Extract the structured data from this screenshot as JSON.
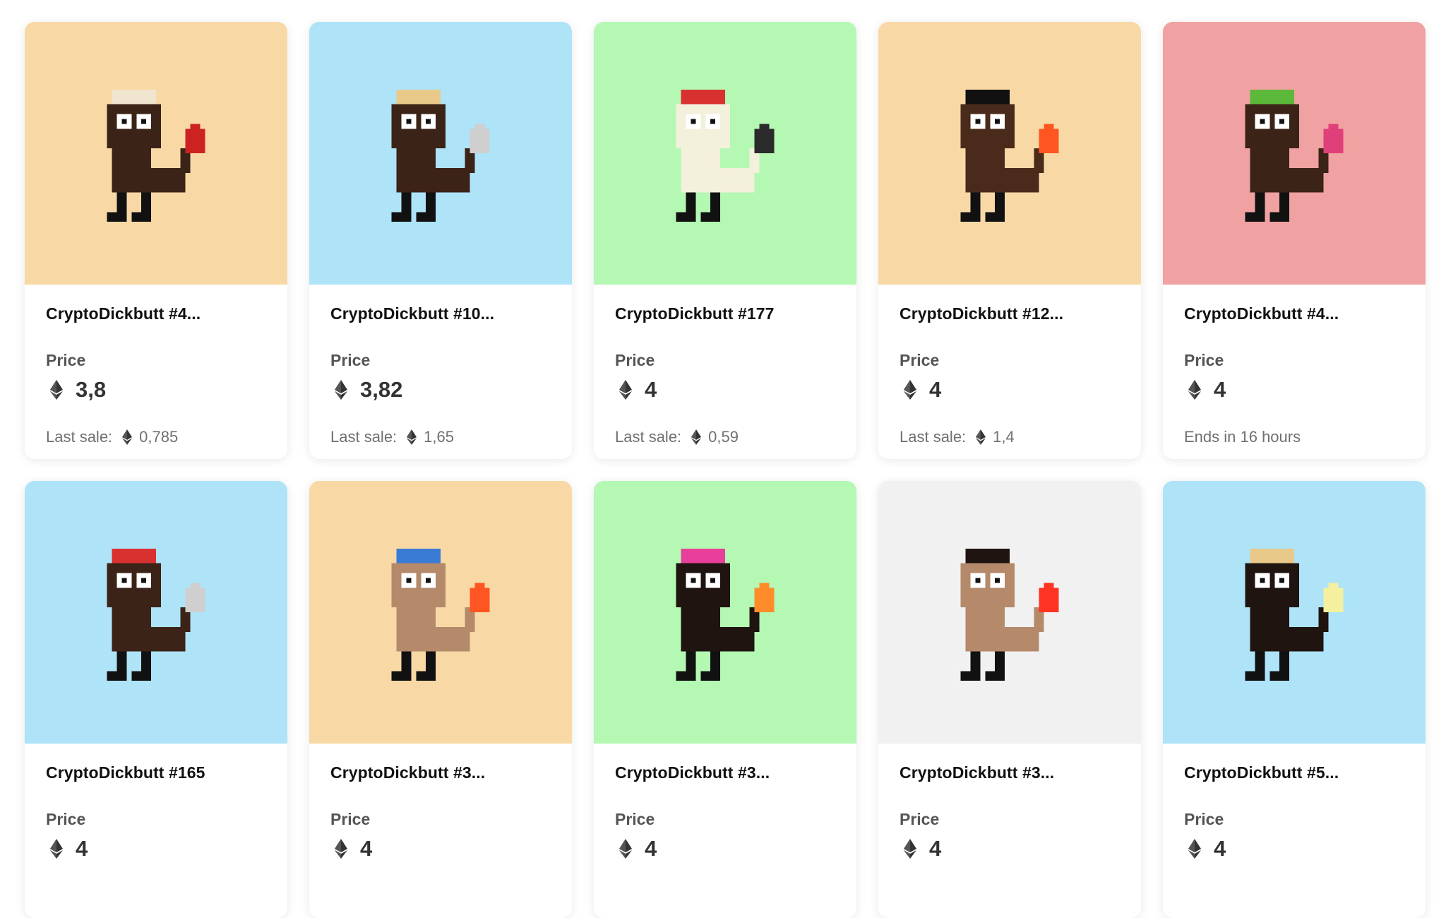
{
  "labels": {
    "price": "Price",
    "last_sale_prefix": "Last sale:"
  },
  "icons": {
    "currency": "ethereum-diamond-icon"
  },
  "cards": [
    {
      "name": "CryptoDickbutt #4...",
      "price": "3,8",
      "footer_type": "last_sale",
      "last_sale": "0,785",
      "bg": "#f8d9a6",
      "body": "#3b2317",
      "hat": "#f0e6d0",
      "prop": "#cc2222"
    },
    {
      "name": "CryptoDickbutt #10...",
      "price": "3,82",
      "footer_type": "last_sale",
      "last_sale": "1,65",
      "bg": "#aee3f8",
      "body": "#3b2317",
      "hat": "#e8c98a",
      "prop": "#cfcfcf"
    },
    {
      "name": "CryptoDickbutt #177",
      "price": "4",
      "footer_type": "last_sale",
      "last_sale": "0,59",
      "bg": "#b4f8b4",
      "body": "#f3f0dc",
      "hat": "#d93030",
      "prop": "#2b2b2b"
    },
    {
      "name": "CryptoDickbutt #12...",
      "price": "4",
      "footer_type": "last_sale",
      "last_sale": "1,4",
      "bg": "#f8d9a6",
      "body": "#4a2a1a",
      "hat": "#111111",
      "prop": "#ff5522"
    },
    {
      "name": "CryptoDickbutt #4...",
      "price": "4",
      "footer_type": "ends",
      "ends_text": "Ends in 16 hours",
      "bg": "#f0a1a1",
      "body": "#3b2317",
      "hat": "#5bb838",
      "prop": "#e0407a"
    },
    {
      "name": "CryptoDickbutt #165",
      "price": "4",
      "footer_type": "none",
      "bg": "#aee3f8",
      "body": "#3b2317",
      "hat": "#d93030",
      "prop": "#cfcfcf"
    },
    {
      "name": "CryptoDickbutt #3...",
      "price": "4",
      "footer_type": "none",
      "bg": "#f8d9a6",
      "body": "#b48a6a",
      "hat": "#3a7bd5",
      "prop": "#ff5522"
    },
    {
      "name": "CryptoDickbutt #3...",
      "price": "4",
      "footer_type": "none",
      "bg": "#b4f8b4",
      "body": "#1f1410",
      "hat": "#e8409a",
      "prop": "#ff8c2a"
    },
    {
      "name": "CryptoDickbutt #3...",
      "price": "4",
      "footer_type": "none",
      "bg": "#f1f1f1",
      "body": "#b48a6a",
      "hat": "#1f1410",
      "prop": "#ff3322"
    },
    {
      "name": "CryptoDickbutt #5...",
      "price": "4",
      "footer_type": "none",
      "bg": "#aee3f8",
      "body": "#1f1410",
      "hat": "#e8c98a",
      "prop": "#f4f0a0"
    }
  ]
}
